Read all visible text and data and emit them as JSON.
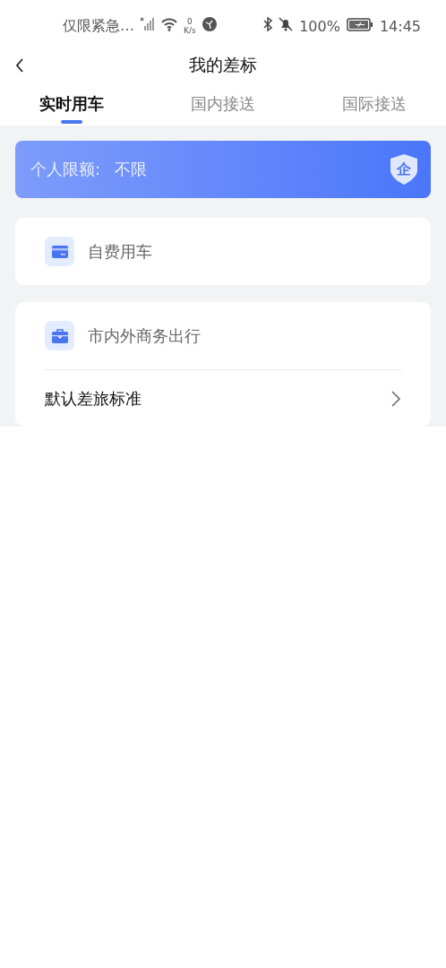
{
  "status_bar": {
    "carrier": "仅限紧急…",
    "net_speed_value": "0",
    "net_speed_unit": "K/s",
    "battery": "100%",
    "time": "14:45"
  },
  "header": {
    "title": "我的差标"
  },
  "tabs": [
    {
      "label": "实时用车",
      "selected": true
    },
    {
      "label": "国内接送",
      "selected": false
    },
    {
      "label": "国际接送",
      "selected": false
    }
  ],
  "quota_banner": {
    "label": "个人限额:",
    "value": "不限",
    "badge": "企"
  },
  "cards": [
    {
      "items": [
        {
          "kind": "category",
          "label": "自费用车"
        }
      ]
    },
    {
      "items": [
        {
          "kind": "category",
          "label": "市内外商务出行"
        },
        {
          "kind": "link",
          "label": "默认差旅标准"
        }
      ]
    }
  ]
}
